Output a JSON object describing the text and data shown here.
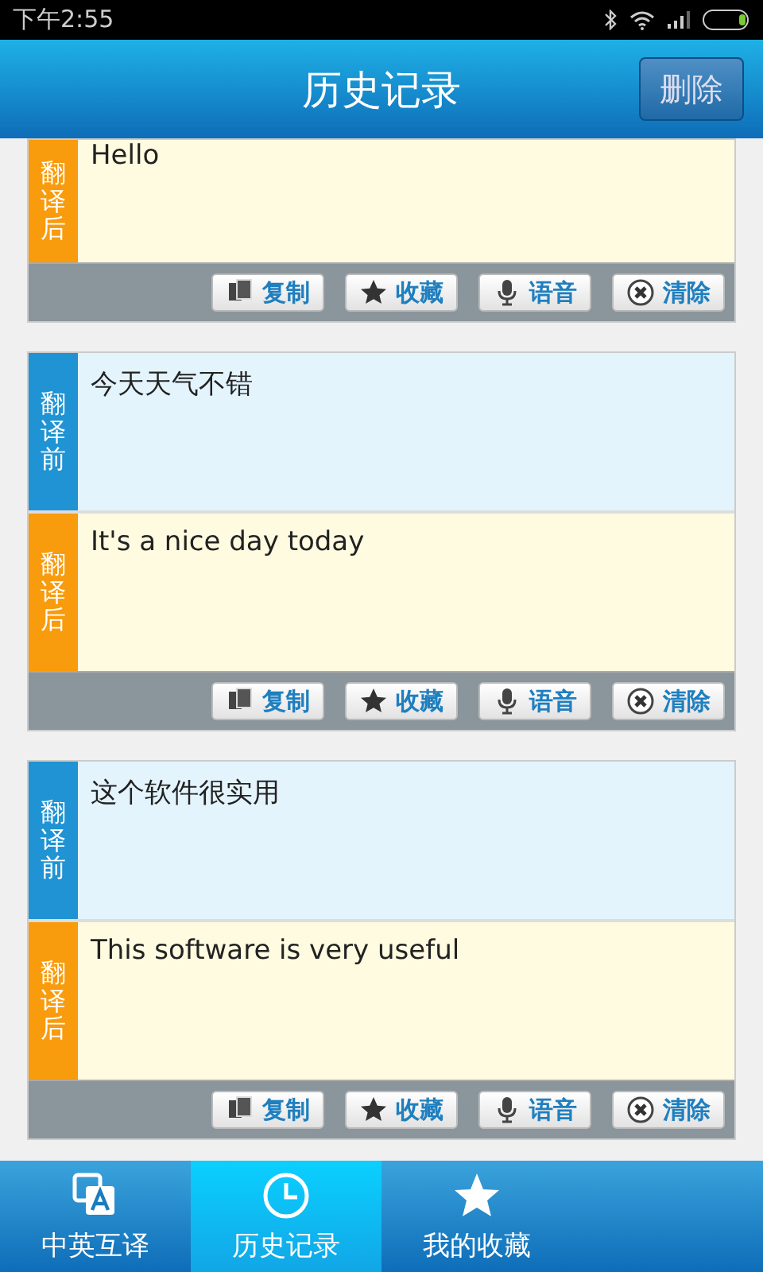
{
  "status_bar": {
    "time": "下午2:55"
  },
  "header": {
    "title": "历史记录",
    "action": "删除"
  },
  "records": [
    {
      "sections": [
        {
          "kind": "after",
          "label": "翻译后",
          "text": "Hello"
        }
      ],
      "actions": [
        {
          "kind": "copy",
          "label": "复制"
        },
        {
          "kind": "favorite",
          "label": "收藏"
        },
        {
          "kind": "voice",
          "label": "语音"
        },
        {
          "kind": "clear",
          "label": "清除"
        }
      ]
    },
    {
      "sections": [
        {
          "kind": "before",
          "label": "翻译前",
          "text": "今天天气不错"
        },
        {
          "kind": "after",
          "label": "翻译后",
          "text": "It's a nice day today"
        }
      ],
      "actions": [
        {
          "kind": "copy",
          "label": "复制"
        },
        {
          "kind": "favorite",
          "label": "收藏"
        },
        {
          "kind": "voice",
          "label": "语音"
        },
        {
          "kind": "clear",
          "label": "清除"
        }
      ]
    },
    {
      "sections": [
        {
          "kind": "before",
          "label": "翻译前",
          "text": "这个软件很实用"
        },
        {
          "kind": "after",
          "label": "翻译后",
          "text": "This software is very useful"
        }
      ],
      "actions": [
        {
          "kind": "copy",
          "label": "复制"
        },
        {
          "kind": "favorite",
          "label": "收藏"
        },
        {
          "kind": "voice",
          "label": "语音"
        },
        {
          "kind": "clear",
          "label": "清除"
        }
      ]
    }
  ],
  "tabs": [
    {
      "kind": "translate",
      "label": "中英互译",
      "selected": false
    },
    {
      "kind": "history",
      "label": "历史记录",
      "selected": true
    },
    {
      "kind": "favorites",
      "label": "我的收藏",
      "selected": false
    }
  ]
}
